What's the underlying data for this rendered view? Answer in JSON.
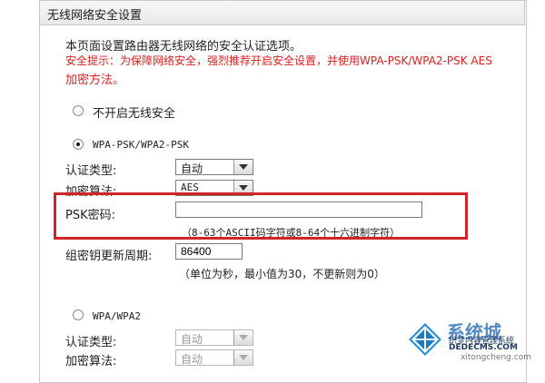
{
  "panel": {
    "title": "无线网络安全设置"
  },
  "intro": {
    "line1": "本页面设置路由器无线网络的安全认证选项。",
    "tip1": "安全提示：为保障网络安全，强烈推荐开启安全设置，并使用WPA-PSK/WPA2-PSK AES",
    "tip2": "加密方法。"
  },
  "options": {
    "no_security": {
      "label": "不开启无线安全",
      "checked": false
    },
    "wpa_psk": {
      "label": "WPA-PSK/WPA2-PSK",
      "checked": true
    },
    "wpa": {
      "label": "WPA/WPA2",
      "checked": false
    }
  },
  "wpa_psk_settings": {
    "auth_label": "认证类型:",
    "auth_value": "自动",
    "enc_label": "加密算法:",
    "enc_value": "AES",
    "psk_label": "PSK密码:",
    "psk_value": "",
    "psk_hint": "（8-63个ASCII码字符或8-64个十六进制字符）",
    "rekey_label": "组密钥更新周期:",
    "rekey_value": "86400",
    "rekey_hint": "（单位为秒，最小值为30，不更新则为0）"
  },
  "wpa_settings": {
    "auth_label": "认证类型:",
    "auth_value": "自动",
    "enc_label": "加密算法:",
    "enc_value": "自动"
  },
  "watermark": {
    "brand": "系统城",
    "line1": "织梦内容管理系统",
    "line2": "DEDECMS.COM",
    "line3": "xitongcheng.com"
  },
  "colors": {
    "warning": "#e11d1d",
    "highlight_box": "#d0242a",
    "watermark_blue": "#2a6fb3"
  }
}
